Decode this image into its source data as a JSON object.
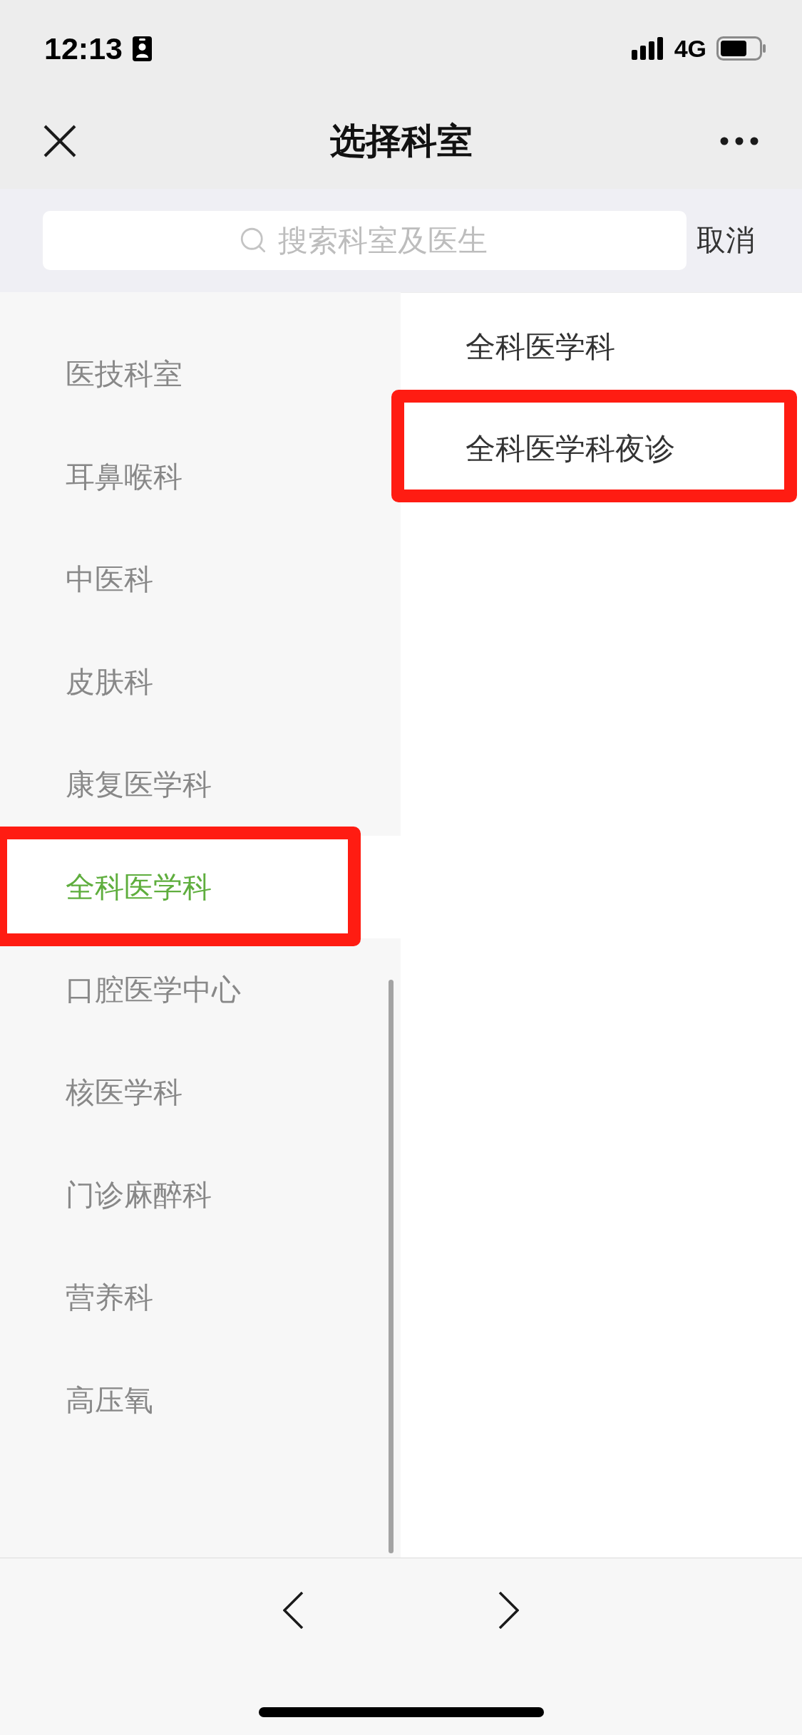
{
  "status_bar": {
    "time": "12:13",
    "network": "4G"
  },
  "nav_bar": {
    "title": "选择科室"
  },
  "search": {
    "placeholder": "搜索科室及医生",
    "cancel": "取消"
  },
  "departments": [
    {
      "name": "医技科室",
      "selected": false,
      "highlighted": false
    },
    {
      "name": "耳鼻喉科",
      "selected": false,
      "highlighted": false
    },
    {
      "name": "中医科",
      "selected": false,
      "highlighted": false
    },
    {
      "name": "皮肤科",
      "selected": false,
      "highlighted": false
    },
    {
      "name": "康复医学科",
      "selected": false,
      "highlighted": false
    },
    {
      "name": "全科医学科",
      "selected": true,
      "highlighted": true
    },
    {
      "name": "口腔医学中心",
      "selected": false,
      "highlighted": false
    },
    {
      "name": "核医学科",
      "selected": false,
      "highlighted": false
    },
    {
      "name": "门诊麻醉科",
      "selected": false,
      "highlighted": false
    },
    {
      "name": "营养科",
      "selected": false,
      "highlighted": false
    },
    {
      "name": "高压氧",
      "selected": false,
      "highlighted": false
    }
  ],
  "sub_departments": [
    {
      "name": "全科医学科",
      "highlighted": false
    },
    {
      "name": "全科医学科夜诊",
      "highlighted": true
    }
  ]
}
